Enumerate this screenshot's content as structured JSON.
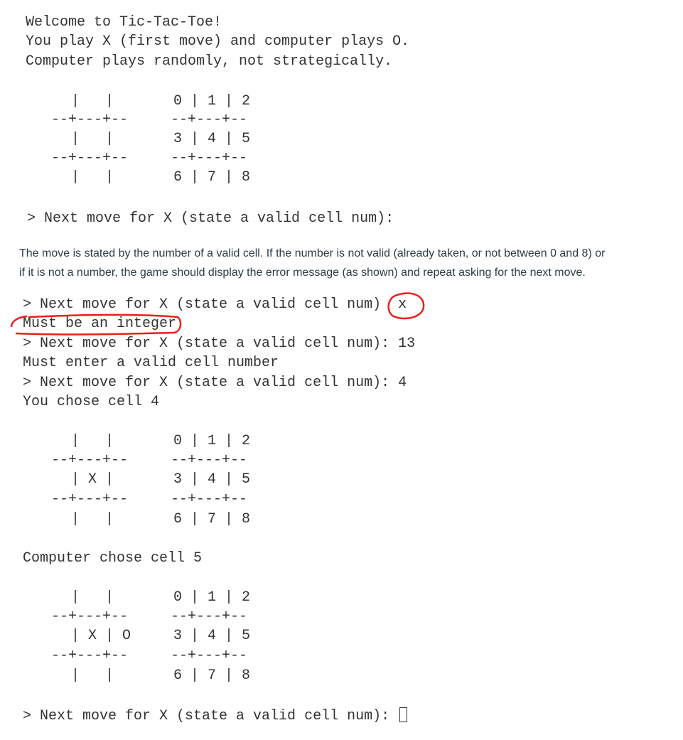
{
  "intro": [
    "Welcome to Tic-Tac-Toe!",
    "You play X (first move) and computer plays O.",
    "Computer plays randomly, not strategically."
  ],
  "board1": [
    "   |   |       0 | 1 | 2",
    "--+---+--     --+---+--",
    "   |   |       3 | 4 | 5",
    "--+---+--     --+---+--",
    "   |   |       6 | 7 | 8"
  ],
  "prompt1": "> Next move for X (state a valid cell num):",
  "instructions": [
    "The move is stated by the number of a valid cell. If the number is not valid (already taken, or not between 0 and 8) or",
    "if it is not a number, the game should display the error message (as shown) and repeat asking for the next move."
  ],
  "session": [
    "> Next move for X (state a valid cell num)  x",
    "Must be an integer",
    "> Next move for X (state a valid cell num): 13",
    "Must enter a valid cell number",
    "> Next move for X (state a valid cell num): 4",
    "You chose cell 4"
  ],
  "board2": [
    "   |   |       0 | 1 | 2",
    "--+---+--     --+---+--",
    "   | X |       3 | 4 | 5",
    "--+---+--     --+---+--",
    "   |   |       6 | 7 | 8"
  ],
  "computer_move": "Computer chose cell 5",
  "board3": [
    "   |   |       0 | 1 | 2",
    "--+---+--     --+---+--",
    "   | X | O     3 | 4 | 5",
    "--+---+--     --+---+--",
    "   |   |       6 | 7 | 8"
  ],
  "prompt_final": "> Next move for X (state a valid cell num): ",
  "annotation_color": "#e8201a"
}
